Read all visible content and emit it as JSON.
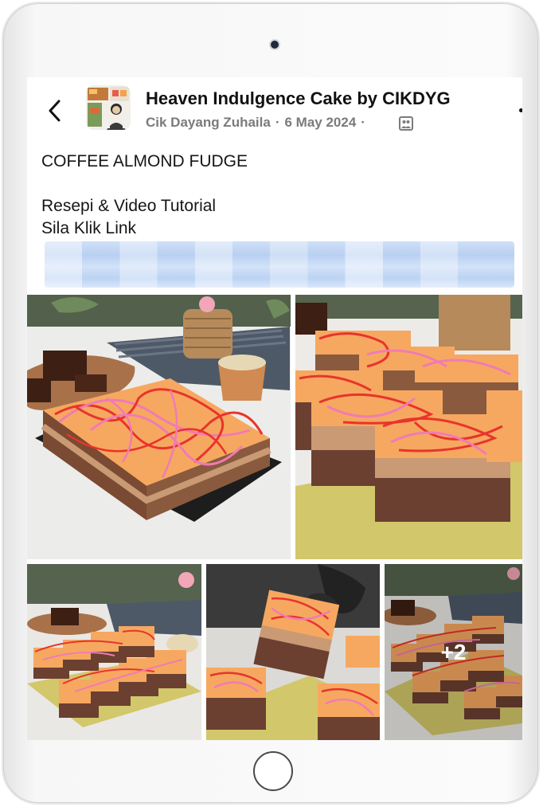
{
  "post": {
    "group_name": "Heaven Indulgence Cake by CIKDYG",
    "author": "Cik Dayang Zuhaila",
    "separator": "·",
    "date": "6 May 2024",
    "audience_icon": "group-audience-icon"
  },
  "body": {
    "title": "COFFEE ALMOND FUDGE",
    "line1": "Resepi & Video Tutorial",
    "line2": "Sila Klik Link"
  },
  "gallery": {
    "more_count": "+2"
  },
  "colors": {
    "name_text": "#111111",
    "meta_text": "#7b7b7b",
    "frosting": "#f6a860",
    "drizzle_pink": "#f07bb5",
    "drizzle_red": "#e8342c"
  }
}
